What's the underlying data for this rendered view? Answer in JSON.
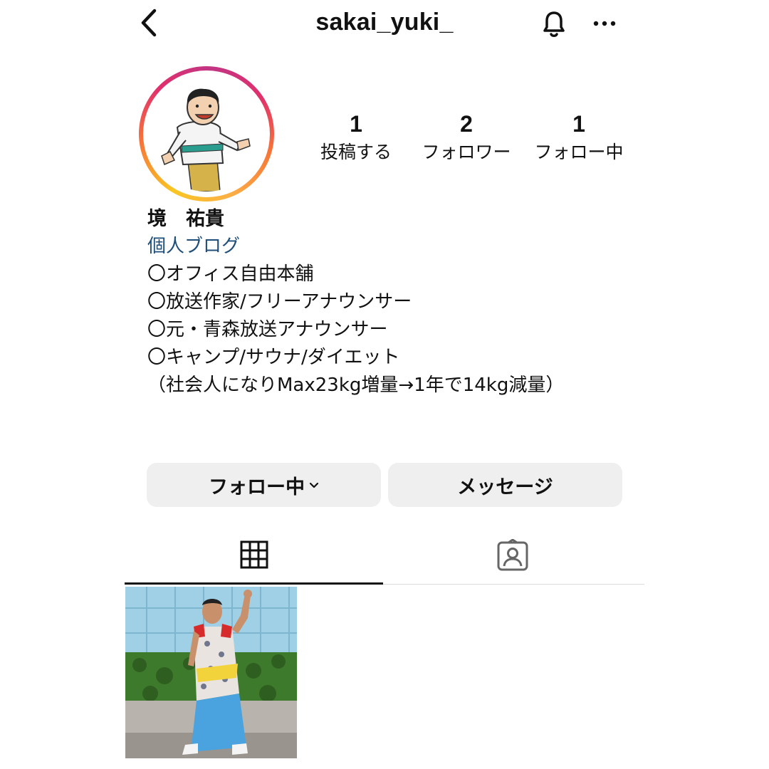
{
  "header": {
    "username": "sakai_yuki_",
    "back_icon": "chevron-left-icon",
    "notify_icon": "bell-icon",
    "more_icon": "more-horizontal-icon"
  },
  "profile": {
    "stats": [
      {
        "count": "1",
        "label": "投稿する"
      },
      {
        "count": "2",
        "label": "フォロワー"
      },
      {
        "count": "1",
        "label": "フォロー中"
      }
    ],
    "name": "境　祐貴",
    "link_text": "個人ブログ",
    "bio_lines": [
      "〇オフィス自由本舗",
      "〇放送作家/フリーアナウンサー",
      "〇元・青森放送アナウンサー",
      "〇キャンプ/サウナ/ダイエット",
      "（社会人になりMax23kg増量→1年で14kg減量）"
    ]
  },
  "actions": {
    "follow_label": "フォロー中",
    "message_label": "メッセージ"
  },
  "tabs": {
    "grid_icon": "grid-icon",
    "tagged_icon": "tagged-person-icon",
    "active": "grid"
  },
  "colors": {
    "link": "#1f4e79",
    "button_bg": "#efefef",
    "ring_start": "#f9c623",
    "ring_end": "#c13584"
  }
}
